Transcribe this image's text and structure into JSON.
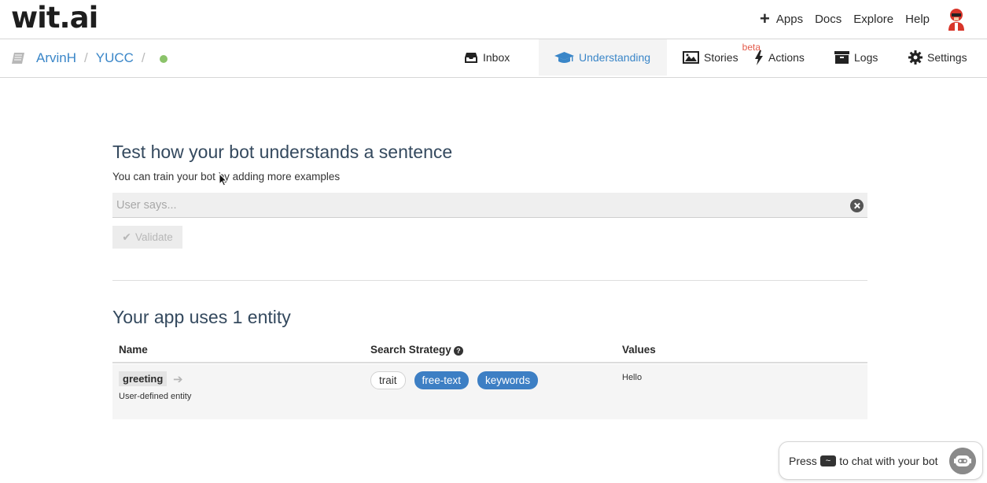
{
  "brand": {
    "logo_text": "wit.ai"
  },
  "topnav": {
    "items": [
      {
        "label": "Apps",
        "icon": "plus-icon"
      },
      {
        "label": "Docs"
      },
      {
        "label": "Explore"
      },
      {
        "label": "Help"
      }
    ],
    "avatar": "user-avatar"
  },
  "breadcrumb": {
    "icon": "book-icon",
    "user": "ArvinH",
    "separator": "/",
    "app": "YUCC",
    "status_color": "#8bc36a"
  },
  "tabs": [
    {
      "label": "Inbox",
      "icon": "inbox-icon",
      "active": false
    },
    {
      "label": "Understanding",
      "icon": "graduation-cap-icon",
      "active": true
    },
    {
      "label": "Stories",
      "icon": "image-icon",
      "badge": "beta",
      "active": false
    },
    {
      "label": "Actions",
      "icon": "bolt-icon",
      "active": false
    },
    {
      "label": "Logs",
      "icon": "archive-icon",
      "active": false
    },
    {
      "label": "Settings",
      "icon": "gear-icon",
      "active": false
    }
  ],
  "test": {
    "heading": "Test how your bot understands a sentence",
    "subheading": "You can train your bot by adding more examples",
    "input_placeholder": "User says...",
    "input_value": "",
    "validate_label": "Validate"
  },
  "entities": {
    "heading": "Your app uses 1 entity",
    "columns": [
      "Name",
      "Search Strategy",
      "Values"
    ],
    "rows": [
      {
        "name": "greeting",
        "description": "User-defined entity",
        "strategies": [
          {
            "label": "trait",
            "enabled": false
          },
          {
            "label": "free-text",
            "enabled": true
          },
          {
            "label": "keywords",
            "enabled": true
          }
        ],
        "values": "Hello"
      }
    ]
  },
  "chat_widget": {
    "prefix": "Press",
    "key": "~",
    "suffix": "to chat with your bot"
  },
  "colors": {
    "accent": "#3a86c8",
    "chip_active": "#3d7fc4",
    "beta": "#e35a4a"
  }
}
